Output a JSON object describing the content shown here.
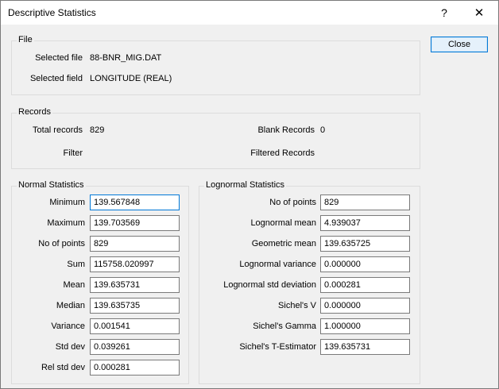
{
  "window": {
    "title": "Descriptive Statistics",
    "help_symbol": "?",
    "close_symbol": "✕"
  },
  "buttons": {
    "close_label": "Close"
  },
  "file_group": {
    "legend": "File",
    "selected_file_label": "Selected file",
    "selected_file_value": "88-BNR_MIG.DAT",
    "selected_field_label": "Selected field",
    "selected_field_value": "LONGITUDE (REAL)"
  },
  "records_group": {
    "legend": "Records",
    "total_records_label": "Total records",
    "total_records_value": "829",
    "blank_records_label": "Blank Records",
    "blank_records_value": "0",
    "filter_label": "Filter",
    "filtered_records_label": "Filtered Records"
  },
  "normal_stats": {
    "legend": "Normal Statistics",
    "rows": [
      {
        "label": "Minimum",
        "value": "139.567848"
      },
      {
        "label": "Maximum",
        "value": "139.703569"
      },
      {
        "label": "No of points",
        "value": "829"
      },
      {
        "label": "Sum",
        "value": "115758.020997"
      },
      {
        "label": "Mean",
        "value": "139.635731"
      },
      {
        "label": "Median",
        "value": "139.635735"
      },
      {
        "label": "Variance",
        "value": "0.001541"
      },
      {
        "label": "Std dev",
        "value": "0.039261"
      },
      {
        "label": "Rel std dev",
        "value": "0.000281"
      }
    ]
  },
  "lognormal_stats": {
    "legend": "Lognormal Statistics",
    "rows": [
      {
        "label": "No of points",
        "value": "829"
      },
      {
        "label": "Lognormal mean",
        "value": "4.939037"
      },
      {
        "label": "Geometric mean",
        "value": "139.635725"
      },
      {
        "label": "Lognormal variance",
        "value": "0.000000"
      },
      {
        "label": "Lognormal std deviation",
        "value": "0.000281"
      },
      {
        "label": "Sichel's V",
        "value": "0.000000"
      },
      {
        "label": "Sichel's Gamma",
        "value": "1.000000"
      },
      {
        "label": "Sichel's T-Estimator",
        "value": "139.635731"
      }
    ]
  }
}
